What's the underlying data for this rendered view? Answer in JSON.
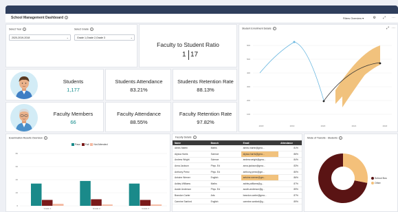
{
  "header": {
    "title": "School Management Dashboard",
    "filters_label": "Filters Overview",
    "icons": [
      "info-icon",
      "chevron-down-icon",
      "sliders-icon",
      "expand-icon",
      "more-icon"
    ]
  },
  "filters": {
    "year_label": "Select Year",
    "year_value": "2020-2019-2018",
    "grade_label": "Select Grade",
    "grade_value": "Grade 1,Grade 2,Grade 3"
  },
  "ratio": {
    "title": "Faculty to Student Ratio",
    "left": "1",
    "right": "17"
  },
  "kpis": {
    "students_label": "Students",
    "students_value": "1,177",
    "students_attendance_label": "Students Attendance",
    "students_attendance_value": "83.21%",
    "students_retention_label": "Students Retention Rate",
    "students_retention_value": "88.13%",
    "faculty_label": "Faculty Members",
    "faculty_value": "66",
    "faculty_attendance_label": "Faculty Attendance",
    "faculty_attendance_value": "88.55%",
    "faculty_retention_label": "Faculty Retention Rate",
    "faculty_retention_value": "97.82%"
  },
  "enrollment": {
    "title": "Student Enrollment Details",
    "x_ticks": [
      "2018",
      "2019",
      "2020",
      "2021",
      "2022"
    ],
    "y_ticks": [
      "600",
      "500",
      "400",
      "300",
      "200",
      "100"
    ]
  },
  "exam": {
    "title": "Examination Results Overview",
    "legend": [
      "Pass",
      "Fail",
      "Not Attended"
    ],
    "colors": [
      "#1a8a8a",
      "#7a1a1a",
      "#f4b8a0"
    ],
    "y_ticks": [
      "80",
      "60",
      "40",
      "20",
      "0"
    ],
    "categories": [
      "Grade 1",
      "Grade 2",
      "Grade 3"
    ],
    "pass": [
      34,
      38,
      34
    ],
    "fail": [
      9,
      10,
      9
    ],
    "not_attended": [
      3,
      2,
      2
    ]
  },
  "faculty_table": {
    "title": "Faculty Details",
    "headers": [
      "Name",
      "Branch",
      "Email",
      "Attendance"
    ],
    "rows": [
      {
        "name": "Alexis Martin",
        "branch": "Maths",
        "email": "alexis.martin@gma...",
        "att": "81%",
        "hl": false
      },
      {
        "name": "Alyssa Harris",
        "branch": "Science",
        "email": "alyssa.harris@gma...",
        "att": "86%",
        "hl": true
      },
      {
        "name": "Andrew Wright",
        "branch": "Science",
        "email": "andrew.wright@gma...",
        "att": "84%",
        "hl": false
      },
      {
        "name": "Anna Jackson",
        "branch": "Phys. Ed",
        "email": "anna.jackson@gma...",
        "att": "83%",
        "hl": false
      },
      {
        "name": "Anthony Perez",
        "branch": "Phys. Ed",
        "email": "anthony.perez@gm...",
        "att": "80%",
        "hl": false
      },
      {
        "name": "Antoine Werner",
        "branch": "English",
        "email": "antoine.werner@gm...",
        "att": "86%",
        "hl": true
      },
      {
        "name": "Ashley Williams",
        "branch": "Maths",
        "email": "ashley.williams@g...",
        "att": "87%",
        "hl": false
      },
      {
        "name": "Austin Anderson",
        "branch": "Phys. Ed",
        "email": "austin.anderson@g...",
        "att": "89%",
        "hl": false
      },
      {
        "name": "Brandon Carter",
        "branch": "Arts",
        "email": "brandon.carter@gma...",
        "att": "87%",
        "hl": false
      },
      {
        "name": "Carmine Sanford",
        "branch": "English",
        "email": "carmine.sanford@g...",
        "att": "89%",
        "hl": false
      }
    ]
  },
  "transport": {
    "title": "Mode of Transits - Students",
    "legend": [
      "School Bus",
      "Other"
    ],
    "colors": [
      "#5a1414",
      "#f4c07a"
    ],
    "values": [
      72,
      28
    ]
  }
}
